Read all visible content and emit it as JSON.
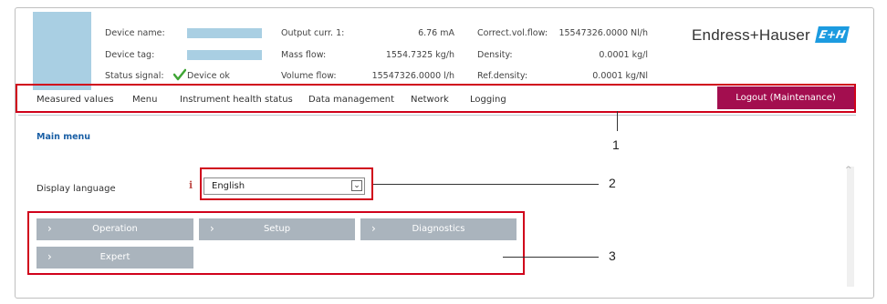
{
  "header": {
    "device_name_label": "Device name:",
    "device_tag_label": "Device tag:",
    "status_signal_label": "Status signal:",
    "status_value": "Device ok",
    "output_curr_label": "Output curr. 1:",
    "output_curr_value": "6.76 mA",
    "mass_flow_label": "Mass flow:",
    "mass_flow_value": "1554.7325 kg/h",
    "volume_flow_label": "Volume flow:",
    "volume_flow_value": "15547326.0000 l/h",
    "correct_vol_flow_label": "Correct.vol.flow:",
    "correct_vol_flow_value": "15547326.0000 Nl/h",
    "density_label": "Density:",
    "density_value": "0.0001 kg/l",
    "ref_density_label": "Ref.density:",
    "ref_density_value": "0.0001 kg/Nl",
    "brand": "Endress+Hauser",
    "brand_logo": "E+H"
  },
  "nav": {
    "items": [
      "Measured values",
      "Menu",
      "Instrument health status",
      "Data management",
      "Network",
      "Logging"
    ],
    "logout": "Logout (Maintenance)"
  },
  "main": {
    "title": "Main menu",
    "display_language_label": "Display language",
    "info_symbol": "i",
    "language_value": "English",
    "tiles": [
      "Operation",
      "Setup",
      "Diagnostics",
      "Expert"
    ]
  },
  "callouts": [
    "1",
    "2",
    "3"
  ],
  "colors": {
    "accent_red": "#d0021b",
    "logout_bg": "#a30e4f",
    "tile_bg": "#aab4bd",
    "placeholder_blue": "#a9cfe3",
    "brand_blue": "#1c9be0"
  },
  "icons": {
    "status": "checkmark-icon",
    "dropdown": "chevron-down-icon",
    "tile": "chevron-right-icon",
    "info": "info-icon"
  }
}
